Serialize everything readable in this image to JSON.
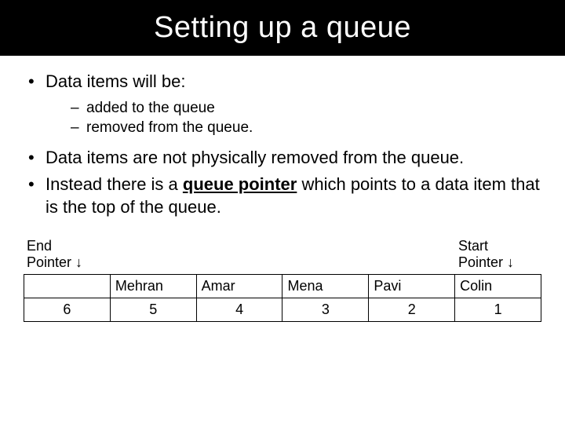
{
  "title": "Setting up a queue",
  "bullets": {
    "b1": "Data items will be:",
    "b1_sub": {
      "s1": "added to the queue",
      "s2": "removed from the queue."
    },
    "b2": "Data items are not physically removed from the queue.",
    "b3_pre": "Instead there is a ",
    "b3_bold": "queue pointer",
    "b3_post": " which points to a data item that is the top of the queue."
  },
  "pointers": {
    "end": "End\nPointer ↓",
    "start": "Start\nPointer ↓",
    "end_line1": "End",
    "end_line2": "Pointer ↓",
    "start_line1": "Start",
    "start_line2": "Pointer ↓"
  },
  "queue": {
    "names": [
      "",
      "Mehran",
      "Amar",
      "Mena",
      "Pavi",
      "Colin"
    ],
    "indices": [
      "6",
      "5",
      "4",
      "3",
      "2",
      "1"
    ]
  },
  "chart_data": {
    "type": "table",
    "title": "Queue contents with start/end pointers",
    "columns_index": [
      6,
      5,
      4,
      3,
      2,
      1
    ],
    "columns_name": [
      "",
      "Mehran",
      "Amar",
      "Mena",
      "Pavi",
      "Colin"
    ],
    "end_pointer_column_index": 6,
    "start_pointer_column_index": 1
  }
}
